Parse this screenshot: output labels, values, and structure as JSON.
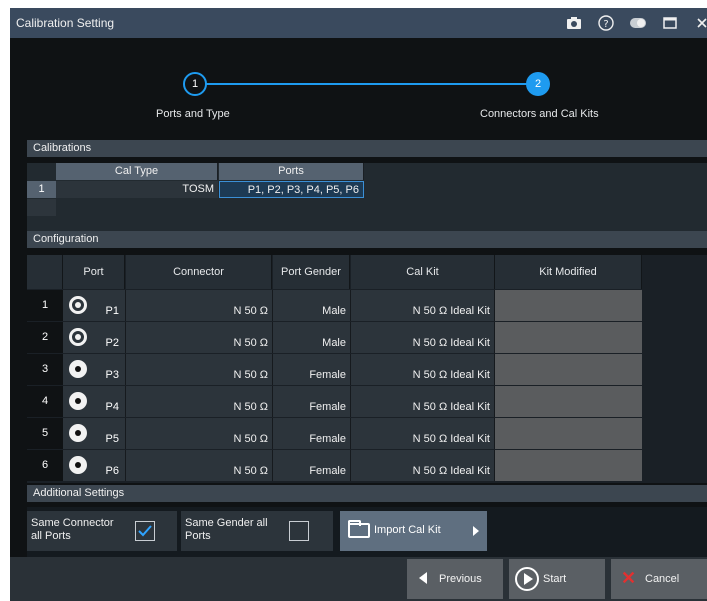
{
  "window": {
    "title": "Calibration Setting"
  },
  "title_icons": [
    "camera-icon",
    "help-icon",
    "toggle-icon",
    "maximize-icon",
    "close-icon"
  ],
  "wizard": {
    "steps": [
      {
        "number": "1",
        "label": "Ports and Type",
        "state": "completed"
      },
      {
        "number": "2",
        "label": "Connectors and Cal Kits",
        "state": "active"
      }
    ],
    "accent_color": "#1e9bf0"
  },
  "calibrations": {
    "section_title": "Calibrations",
    "columns": [
      "Cal Type",
      "Ports"
    ],
    "rows": [
      {
        "index": "1",
        "cal_type": "TOSM",
        "ports": "P1, P2, P3, P4, P5, P6"
      }
    ]
  },
  "configuration": {
    "section_title": "Configuration",
    "columns": [
      "Port",
      "Connector",
      "Port Gender",
      "Cal Kit",
      "Kit Modified"
    ],
    "rows": [
      {
        "index": "1",
        "port": "P1",
        "gender_icon": "male",
        "connector": "N 50 Ω",
        "gender": "Male",
        "cal_kit": "N 50 Ω Ideal Kit"
      },
      {
        "index": "2",
        "port": "P2",
        "gender_icon": "male",
        "connector": "N 50 Ω",
        "gender": "Male",
        "cal_kit": "N 50 Ω Ideal Kit"
      },
      {
        "index": "3",
        "port": "P3",
        "gender_icon": "female",
        "connector": "N 50 Ω",
        "gender": "Female",
        "cal_kit": "N 50 Ω Ideal Kit"
      },
      {
        "index": "4",
        "port": "P4",
        "gender_icon": "female",
        "connector": "N 50 Ω",
        "gender": "Female",
        "cal_kit": "N 50 Ω Ideal Kit"
      },
      {
        "index": "5",
        "port": "P5",
        "gender_icon": "female",
        "connector": "N 50 Ω",
        "gender": "Female",
        "cal_kit": "N 50 Ω Ideal Kit"
      },
      {
        "index": "6",
        "port": "P6",
        "gender_icon": "female",
        "connector": "N 50 Ω",
        "gender": "Female",
        "cal_kit": "N 50 Ω Ideal Kit"
      }
    ]
  },
  "additional_settings": {
    "section_title": "Additional Settings",
    "same_connector": {
      "label": "Same Connector all Ports",
      "checked": true
    },
    "same_gender": {
      "label": "Same Gender all Ports",
      "checked": false
    },
    "import_button": "Import Cal Kit"
  },
  "footer": {
    "previous": "Previous",
    "start": "Start",
    "cancel": "Cancel"
  }
}
